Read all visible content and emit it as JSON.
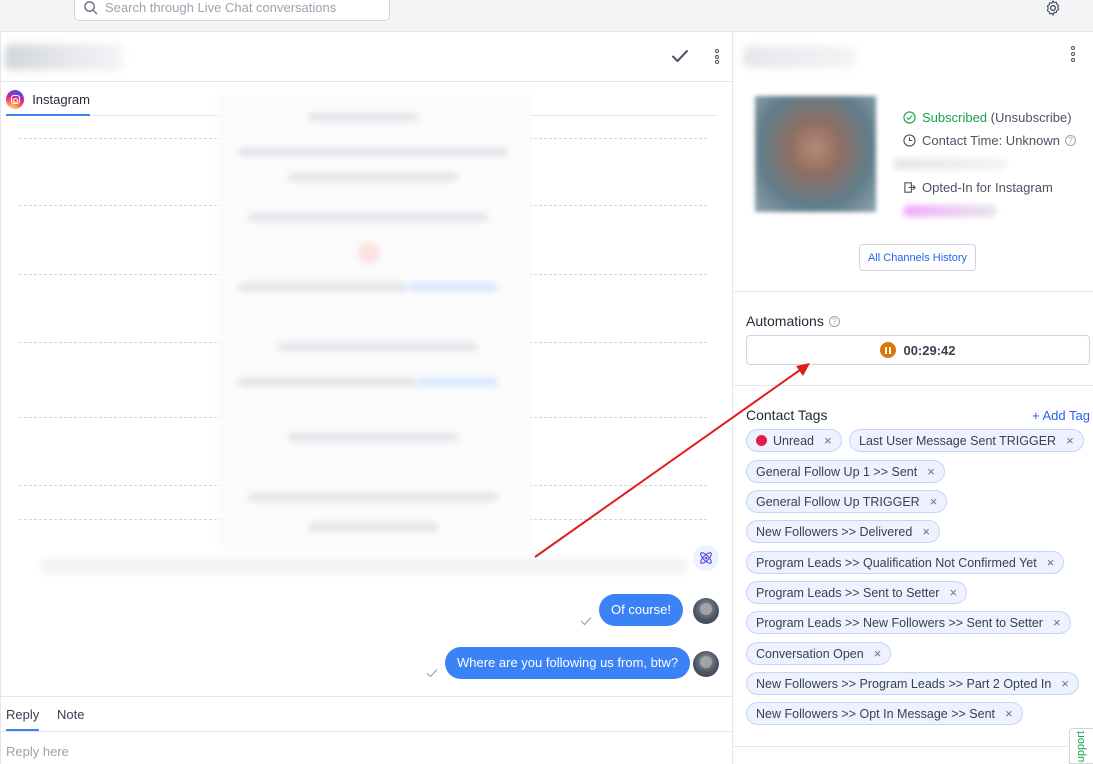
{
  "search": {
    "placeholder": "Search through Live Chat conversations"
  },
  "chat": {
    "channel_tab": "Instagram",
    "messages": [
      {
        "text": "Of course!"
      },
      {
        "text": "Where are you following us from, btw?"
      }
    ],
    "reply_tabs": [
      "Reply",
      "Note"
    ],
    "reply_placeholder": "Reply here"
  },
  "contact": {
    "subscribed": "Subscribed",
    "unsubscribe": "(Unsubscribe)",
    "contact_time": "Contact Time: Unknown",
    "opted_in": "Opted-In for Instagram",
    "history_button": "All Channels History"
  },
  "automations": {
    "title": "Automations",
    "timer": "00:29:42"
  },
  "tags": {
    "title": "Contact Tags",
    "add_label": "+ Add Tag",
    "items": [
      "Unread",
      "Last User Message Sent TRIGGER",
      "General Follow Up 1 >> Sent",
      "General Follow Up TRIGGER",
      "New Followers >> Delivered",
      "Program Leads >> Qualification Not Confirmed Yet",
      "Program Leads >> Sent to Setter",
      "Program Leads >> New Followers >> Sent to Setter",
      "Conversation Open",
      "New Followers >> Program Leads >> Part 2 Opted In",
      "New Followers >> Opt In Message >> Sent"
    ],
    "remove_symbol": "×"
  },
  "support_tab": "Support",
  "colors": {
    "accent": "#3b82f6",
    "subscribed": "#16a34a",
    "timer": "#d97706",
    "annotation_arrow": "#e11d1d"
  }
}
